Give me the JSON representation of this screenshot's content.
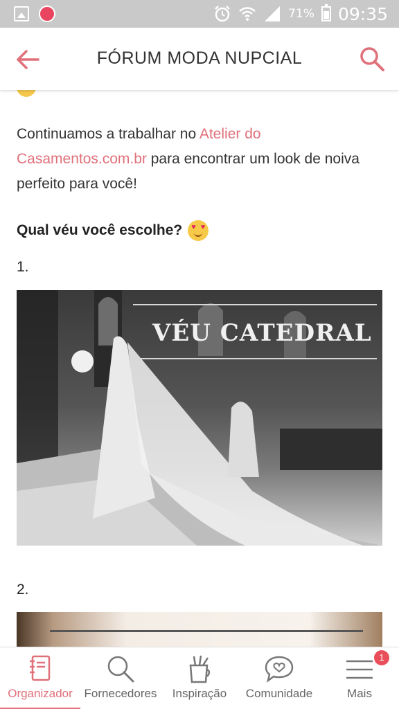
{
  "status_bar": {
    "battery_percent": "71%",
    "time": "09:35"
  },
  "header": {
    "title": "FÓRUM MODA NUPCIAL",
    "accent_color": "#e0707a"
  },
  "post": {
    "paragraph_before_link": "Continuamos a trabalhar no ",
    "link_text": "Atelier do Casamentos.com.br",
    "paragraph_after_link": " para encontrar um look de noiva perfeito para você!",
    "question": "Qual véu você escolhe?",
    "item1_number": "1.",
    "item1_image_caption": "VÉU CATEDRAL",
    "item2_number": "2."
  },
  "bottom_nav": {
    "items": [
      {
        "label": "Organizador",
        "icon": "notebook-icon"
      },
      {
        "label": "Fornecedores",
        "icon": "search-icon"
      },
      {
        "label": "Inspiração",
        "icon": "cup-icon"
      },
      {
        "label": "Comunidade",
        "icon": "chat-heart-icon"
      },
      {
        "label": "Mais",
        "icon": "menu-icon"
      }
    ],
    "more_badge": "1"
  }
}
